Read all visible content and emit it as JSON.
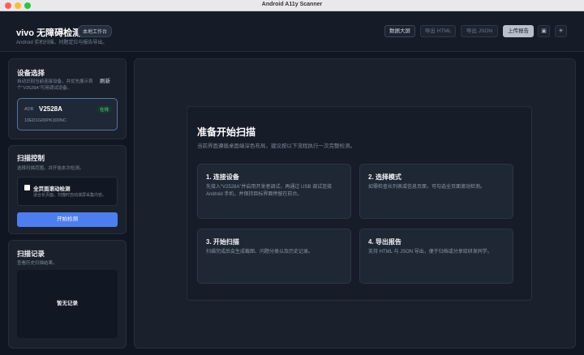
{
  "window": {
    "title": "Android A11y Scanner"
  },
  "header": {
    "brand": "vivo 无障碍检测",
    "badge": "本地工作台",
    "subtitle": "Android 实机扫描，问题定位与报告导出。",
    "buttons": {
      "dashboard": "数据大屏",
      "export_html": "导出 HTML",
      "export_json": "导出 JSON",
      "upload": "上传报告"
    },
    "icons": {
      "save": "▣",
      "theme": "☀"
    }
  },
  "sidebar": {
    "device": {
      "title": "设备选择",
      "refresh": "刷新",
      "desc": "自动识别当前连接设备，并优先展示首个“V2528A”可用调试设备。",
      "model": "V2528A",
      "status": "在线",
      "serial": "10ED1G00PK300NC"
    },
    "scan": {
      "title": "扫描控制",
      "desc": "选择扫描范围，并开始本次检测。",
      "option_label": "全页面滚动检测",
      "option_desc": "适合长页面，扫描时自动滚屏采集内容。",
      "start": "开始检测"
    },
    "history": {
      "title": "扫描记录",
      "desc": "查看历史扫描结果。",
      "empty": "暂无记录"
    }
  },
  "main": {
    "title": "准备开始扫描",
    "desc": "当前界面遵循桌面端深色布局，建议按以下流程执行一次完整检测。",
    "steps": [
      {
        "title": "1. 连接设备",
        "desc": "先接入“V2528A”并启用开发者调试，再通过 USB 调试连接 Android 手机，并保持目标界面停留在前台。"
      },
      {
        "title": "2. 选择模式",
        "desc": "如需检查长列表或信息页面，可勾选全页面滚动检测。"
      },
      {
        "title": "3. 开始扫描",
        "desc": "扫描完成后会生成截图、问题分类以及历史记录。"
      },
      {
        "title": "4. 导出报告",
        "desc": "支持 HTML 与 JSON 导出，便于归档或分享给研发同学。"
      }
    ]
  }
}
